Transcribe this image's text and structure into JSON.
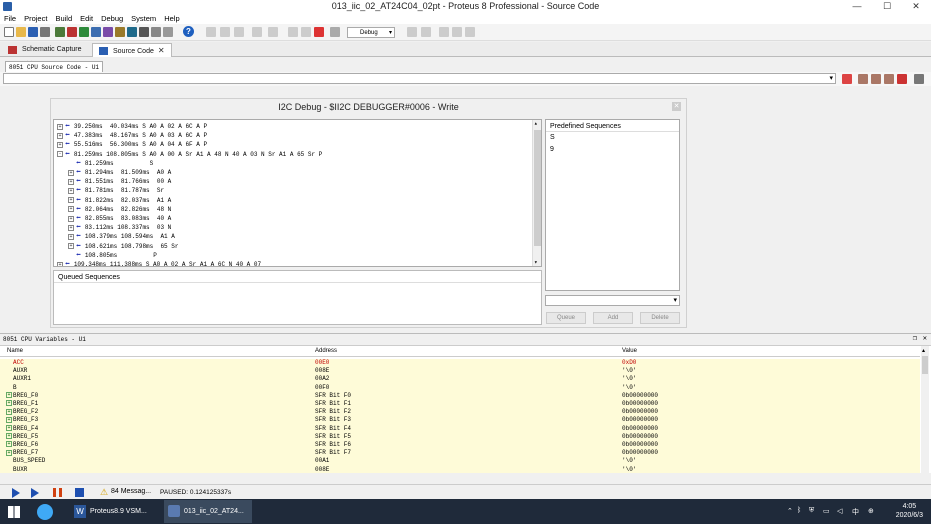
{
  "window": {
    "title": "013_iic_02_AT24C04_02pt - Proteus 8 Professional - Source Code"
  },
  "menu": [
    "File",
    "Project",
    "Build",
    "Edit",
    "Debug",
    "System",
    "Help"
  ],
  "toolbar": {
    "config_select": "Debug"
  },
  "doc_tabs": [
    {
      "label": "Schematic Capture"
    },
    {
      "label": "Source Code"
    }
  ],
  "source_panel": {
    "tab_label": "8051 CPU Source Code - U1"
  },
  "dialog": {
    "title": "I2C Debug - $II2C DEBUGGER#0006 - Write",
    "trace_rows": [
      {
        "sign": "+",
        "text": "39.250ms  40.034ms S A0 A 02 A 6C A P"
      },
      {
        "sign": "+",
        "text": "47.383ms  48.167ms S A0 A 03 A 6C A P"
      },
      {
        "sign": "+",
        "text": "55.516ms  56.300ms S A0 A 04 A 6F A P"
      },
      {
        "sign": "-",
        "text": "81.259ms 108.805ms S A0 A 00 A Sr A1 A 48 N 40 A 03 N Sr A1 A 65 Sr P"
      },
      {
        "sign": "",
        "text": "81.259ms          S"
      },
      {
        "sign": "+",
        "text": "81.294ms  81.509ms  A0 A"
      },
      {
        "sign": "+",
        "text": "81.551ms  81.766ms  00 A"
      },
      {
        "sign": "+",
        "text": "81.781ms  81.787ms  Sr"
      },
      {
        "sign": "+",
        "text": "81.822ms  82.037ms  A1 A"
      },
      {
        "sign": "+",
        "text": "82.064ms  82.826ms  48 N"
      },
      {
        "sign": "+",
        "text": "82.855ms  83.083ms  40 A"
      },
      {
        "sign": "+",
        "text": "83.112ms 108.337ms  03 N"
      },
      {
        "sign": "+",
        "text": "108.379ms 108.594ms  A1 A"
      },
      {
        "sign": "+",
        "text": "108.621ms 108.798ms  65 Sr"
      },
      {
        "sign": "",
        "text": "108.805ms          P"
      },
      {
        "sign": "+",
        "text": "109.348ms 111.388ms S A0 A 02 A Sr A1 A 6C N 40 A 07"
      }
    ],
    "queued_label": "Queued Sequences",
    "predefined_label": "Predefined Sequences",
    "predefined_items": [
      "S",
      "9"
    ],
    "buttons": {
      "queue": "Queue",
      "add": "Add",
      "delete": "Delete"
    }
  },
  "variables": {
    "title": "8051 CPU Variables - U1",
    "columns": {
      "name": "Name",
      "address": "Address",
      "value": "Value"
    },
    "rows": [
      {
        "name": "ACC",
        "address": "00E0",
        "value": "0xD0",
        "highlight": true,
        "expand": false
      },
      {
        "name": "AUXR",
        "address": "008E",
        "value": "'\\0'",
        "highlight": false,
        "expand": false
      },
      {
        "name": "AUXR1",
        "address": "00A2",
        "value": "'\\0'",
        "highlight": false,
        "expand": false
      },
      {
        "name": "B",
        "address": "00F0",
        "value": "'\\0'",
        "highlight": false,
        "expand": false
      },
      {
        "name": "BREG_F0",
        "address": "SFR Bit F0",
        "value": "0b00000000",
        "highlight": false,
        "expand": true
      },
      {
        "name": "BREG_F1",
        "address": "SFR Bit F1",
        "value": "0b00000000",
        "highlight": false,
        "expand": true
      },
      {
        "name": "BREG_F2",
        "address": "SFR Bit F2",
        "value": "0b00000000",
        "highlight": false,
        "expand": true
      },
      {
        "name": "BREG_F3",
        "address": "SFR Bit F3",
        "value": "0b00000000",
        "highlight": false,
        "expand": true
      },
      {
        "name": "BREG_F4",
        "address": "SFR Bit F4",
        "value": "0b00000000",
        "highlight": false,
        "expand": true
      },
      {
        "name": "BREG_F5",
        "address": "SFR Bit F5",
        "value": "0b00000000",
        "highlight": false,
        "expand": true
      },
      {
        "name": "BREG_F6",
        "address": "SFR Bit F6",
        "value": "0b00000000",
        "highlight": false,
        "expand": true
      },
      {
        "name": "BREG_F7",
        "address": "SFR Bit F7",
        "value": "0b00000000",
        "highlight": false,
        "expand": true
      },
      {
        "name": "BUS_SPEED",
        "address": "00A1",
        "value": "'\\0'",
        "highlight": false,
        "expand": false
      },
      {
        "name": "BUXR",
        "address": "008E",
        "value": "'\\0'",
        "highlight": false,
        "expand": false
      }
    ]
  },
  "statusbar": {
    "messages": "84 Messag...",
    "paused": "PAUSED: 0.124125337s"
  },
  "taskbar": {
    "tasks": [
      "Proteus8.9 VSM...",
      "013_iic_02_AT24..."
    ],
    "tray_lang": "中",
    "time": "4:05",
    "date": "2020/6/3"
  },
  "colors": {
    "accent_blue": "#1a2bb0",
    "highlight_red": "#c00000",
    "row_yellow": "#fefbd8",
    "taskbar": "#1f2a3a"
  }
}
